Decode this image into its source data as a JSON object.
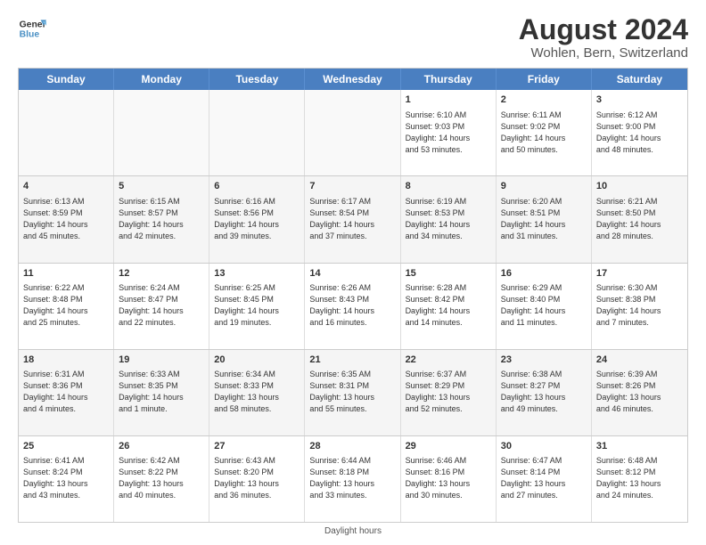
{
  "logo": {
    "line1": "General",
    "line2": "Blue"
  },
  "title": "August 2024",
  "subtitle": "Wohlen, Bern, Switzerland",
  "days": [
    "Sunday",
    "Monday",
    "Tuesday",
    "Wednesday",
    "Thursday",
    "Friday",
    "Saturday"
  ],
  "weeks": [
    [
      {
        "day": "",
        "info": ""
      },
      {
        "day": "",
        "info": ""
      },
      {
        "day": "",
        "info": ""
      },
      {
        "day": "",
        "info": ""
      },
      {
        "day": "1",
        "info": "Sunrise: 6:10 AM\nSunset: 9:03 PM\nDaylight: 14 hours\nand 53 minutes."
      },
      {
        "day": "2",
        "info": "Sunrise: 6:11 AM\nSunset: 9:02 PM\nDaylight: 14 hours\nand 50 minutes."
      },
      {
        "day": "3",
        "info": "Sunrise: 6:12 AM\nSunset: 9:00 PM\nDaylight: 14 hours\nand 48 minutes."
      }
    ],
    [
      {
        "day": "4",
        "info": "Sunrise: 6:13 AM\nSunset: 8:59 PM\nDaylight: 14 hours\nand 45 minutes."
      },
      {
        "day": "5",
        "info": "Sunrise: 6:15 AM\nSunset: 8:57 PM\nDaylight: 14 hours\nand 42 minutes."
      },
      {
        "day": "6",
        "info": "Sunrise: 6:16 AM\nSunset: 8:56 PM\nDaylight: 14 hours\nand 39 minutes."
      },
      {
        "day": "7",
        "info": "Sunrise: 6:17 AM\nSunset: 8:54 PM\nDaylight: 14 hours\nand 37 minutes."
      },
      {
        "day": "8",
        "info": "Sunrise: 6:19 AM\nSunset: 8:53 PM\nDaylight: 14 hours\nand 34 minutes."
      },
      {
        "day": "9",
        "info": "Sunrise: 6:20 AM\nSunset: 8:51 PM\nDaylight: 14 hours\nand 31 minutes."
      },
      {
        "day": "10",
        "info": "Sunrise: 6:21 AM\nSunset: 8:50 PM\nDaylight: 14 hours\nand 28 minutes."
      }
    ],
    [
      {
        "day": "11",
        "info": "Sunrise: 6:22 AM\nSunset: 8:48 PM\nDaylight: 14 hours\nand 25 minutes."
      },
      {
        "day": "12",
        "info": "Sunrise: 6:24 AM\nSunset: 8:47 PM\nDaylight: 14 hours\nand 22 minutes."
      },
      {
        "day": "13",
        "info": "Sunrise: 6:25 AM\nSunset: 8:45 PM\nDaylight: 14 hours\nand 19 minutes."
      },
      {
        "day": "14",
        "info": "Sunrise: 6:26 AM\nSunset: 8:43 PM\nDaylight: 14 hours\nand 16 minutes."
      },
      {
        "day": "15",
        "info": "Sunrise: 6:28 AM\nSunset: 8:42 PM\nDaylight: 14 hours\nand 14 minutes."
      },
      {
        "day": "16",
        "info": "Sunrise: 6:29 AM\nSunset: 8:40 PM\nDaylight: 14 hours\nand 11 minutes."
      },
      {
        "day": "17",
        "info": "Sunrise: 6:30 AM\nSunset: 8:38 PM\nDaylight: 14 hours\nand 7 minutes."
      }
    ],
    [
      {
        "day": "18",
        "info": "Sunrise: 6:31 AM\nSunset: 8:36 PM\nDaylight: 14 hours\nand 4 minutes."
      },
      {
        "day": "19",
        "info": "Sunrise: 6:33 AM\nSunset: 8:35 PM\nDaylight: 14 hours\nand 1 minute."
      },
      {
        "day": "20",
        "info": "Sunrise: 6:34 AM\nSunset: 8:33 PM\nDaylight: 13 hours\nand 58 minutes."
      },
      {
        "day": "21",
        "info": "Sunrise: 6:35 AM\nSunset: 8:31 PM\nDaylight: 13 hours\nand 55 minutes."
      },
      {
        "day": "22",
        "info": "Sunrise: 6:37 AM\nSunset: 8:29 PM\nDaylight: 13 hours\nand 52 minutes."
      },
      {
        "day": "23",
        "info": "Sunrise: 6:38 AM\nSunset: 8:27 PM\nDaylight: 13 hours\nand 49 minutes."
      },
      {
        "day": "24",
        "info": "Sunrise: 6:39 AM\nSunset: 8:26 PM\nDaylight: 13 hours\nand 46 minutes."
      }
    ],
    [
      {
        "day": "25",
        "info": "Sunrise: 6:41 AM\nSunset: 8:24 PM\nDaylight: 13 hours\nand 43 minutes."
      },
      {
        "day": "26",
        "info": "Sunrise: 6:42 AM\nSunset: 8:22 PM\nDaylight: 13 hours\nand 40 minutes."
      },
      {
        "day": "27",
        "info": "Sunrise: 6:43 AM\nSunset: 8:20 PM\nDaylight: 13 hours\nand 36 minutes."
      },
      {
        "day": "28",
        "info": "Sunrise: 6:44 AM\nSunset: 8:18 PM\nDaylight: 13 hours\nand 33 minutes."
      },
      {
        "day": "29",
        "info": "Sunrise: 6:46 AM\nSunset: 8:16 PM\nDaylight: 13 hours\nand 30 minutes."
      },
      {
        "day": "30",
        "info": "Sunrise: 6:47 AM\nSunset: 8:14 PM\nDaylight: 13 hours\nand 27 minutes."
      },
      {
        "day": "31",
        "info": "Sunrise: 6:48 AM\nSunset: 8:12 PM\nDaylight: 13 hours\nand 24 minutes."
      }
    ]
  ],
  "footer": "Daylight hours"
}
